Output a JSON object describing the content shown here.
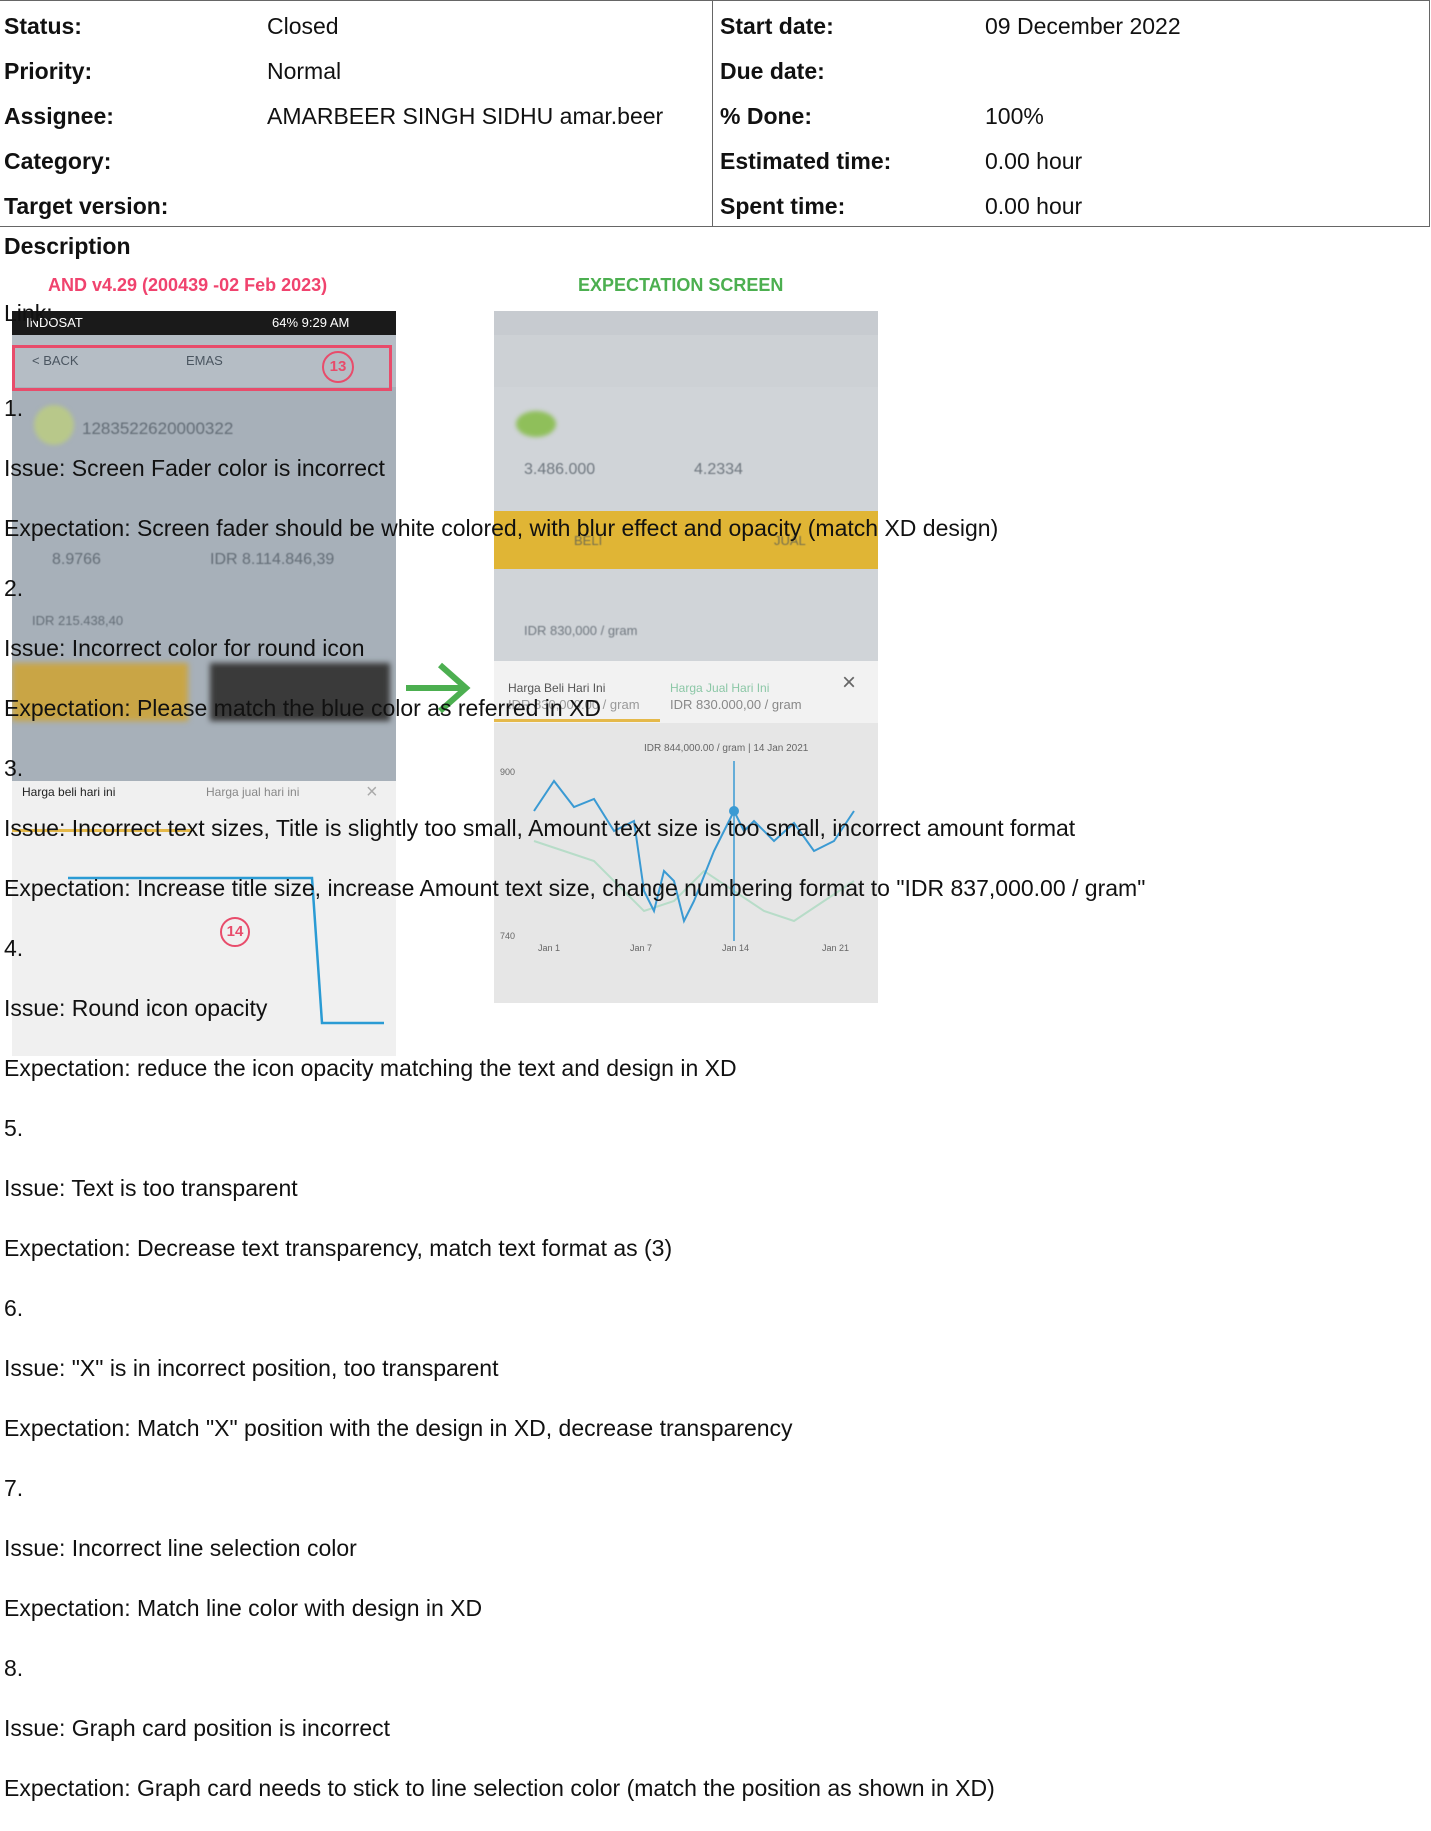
{
  "attributes": {
    "left": [
      {
        "label": "Status:",
        "value": "Closed"
      },
      {
        "label": "Priority:",
        "value": "Normal"
      },
      {
        "label": "Assignee:",
        "value": "AMARBEER SINGH SIDHU amar.beer"
      },
      {
        "label": "Category:",
        "value": ""
      },
      {
        "label": "Target version:",
        "value": ""
      }
    ],
    "right": [
      {
        "label": "Start date:",
        "value": "09 December 2022"
      },
      {
        "label": "Due date:",
        "value": ""
      },
      {
        "label": "% Done:",
        "value": "100%"
      },
      {
        "label": "Estimated time:",
        "value": "0.00 hour"
      },
      {
        "label": "Spent time:",
        "value": "0.00 hour"
      }
    ]
  },
  "description_heading": "Description",
  "screenshot": {
    "left_title": "AND v4.29 (200439 -02 Feb 2023)",
    "right_title": "EXPECTATION SCREEN",
    "status_carrier": "INDOSAT",
    "status_right": "64% 9:29 AM",
    "back": "< BACK",
    "screen_title": "EMAS",
    "account_number": "1283522620000322",
    "balance_left": "8.9766",
    "balance_right": "IDR 8.114.846,39",
    "potential_value": "IDR 215.438,40",
    "buy_legend": "Harga beli hari ini",
    "sell_legend": "Harga jual hari ini",
    "marker_13": "13",
    "marker_14": "14",
    "right_balance_left": "3.486.000",
    "right_balance_right": "4.2334",
    "right_buy_label": "BELI",
    "right_sell_label": "JUAL",
    "right_price_hint": "IDR 830,000 / gram",
    "right_buy_legend": "Harga Beli Hari Ini",
    "right_sell_legend": "Harga Jual Hari Ini",
    "right_buy_amount": "IDR 830,000.00 / gram",
    "right_sell_amount": "IDR 830.000,00 / gram",
    "right_tooltip": "IDR 844,000.00 / gram | 14 Jan 2021",
    "right_y_top": "900",
    "right_y_bottom": "740",
    "right_x_ticks": [
      "Jan 1",
      "Jan 7",
      "Jan 14",
      "Jan 21"
    ],
    "close_glyph": "×"
  },
  "description_lines": [
    "Link:",
    "1.",
    "Issue: Screen Fader color is incorrect",
    "Expectation: Screen fader should be white colored, with blur effect and opacity (match XD design)",
    "2.",
    "Issue: Incorrect color for round icon",
    "Expectation: Please match the blue color as referred in XD",
    "3.",
    "Issue: Incorrect text sizes, Title is slightly too small, Amount text size is too small, incorrect amount format",
    "Expectation: Increase title size, increase Amount text size, change numbering format to \"IDR 837,000.00 / gram\"",
    "4.",
    "Issue: Round icon opacity",
    "Expectation: reduce the icon opacity matching the text and design in XD",
    "5.",
    "Issue: Text is too transparent",
    "Expectation: Decrease text transparency, match text format as (3)",
    "6.",
    "Issue: \"X\" is in incorrect position, too transparent",
    "Expectation: Match \"X\" position with the design in XD, decrease transparency",
    "7.",
    "Issue: Incorrect line selection color",
    "Expectation: Match line color with design in XD",
    "8.",
    "Issue: Graph card position is incorrect",
    "Expectation: Graph card needs to stick to line selection color (match the position as shown in XD)"
  ]
}
